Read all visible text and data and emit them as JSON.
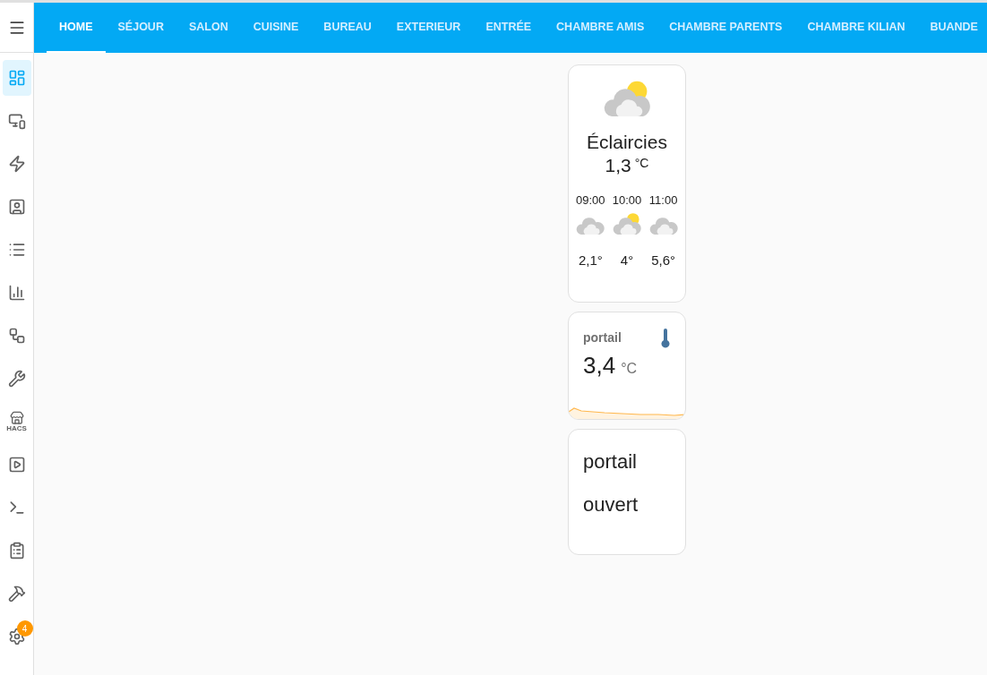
{
  "sidebar": {
    "items": [
      {
        "selected": true
      },
      {
        "selected": false
      },
      {
        "selected": false
      },
      {
        "selected": false
      },
      {
        "selected": false
      },
      {
        "selected": false
      },
      {
        "selected": false
      },
      {
        "selected": false
      },
      {
        "label": "HACS",
        "selected": false
      },
      {
        "selected": false
      },
      {
        "selected": false
      },
      {
        "selected": false
      },
      {
        "selected": false
      },
      {
        "badge": "4",
        "selected": false
      }
    ]
  },
  "tabs": [
    {
      "label": "HOME",
      "selected": true
    },
    {
      "label": "SÉJOUR",
      "selected": false
    },
    {
      "label": "SALON",
      "selected": false
    },
    {
      "label": "CUISINE",
      "selected": false
    },
    {
      "label": "BUREAU",
      "selected": false
    },
    {
      "label": "EXTERIEUR",
      "selected": false
    },
    {
      "label": "ENTRÉE",
      "selected": false
    },
    {
      "label": "CHAMBRE AMIS",
      "selected": false
    },
    {
      "label": "CHAMBRE PARENTS",
      "selected": false
    },
    {
      "label": "CHAMBRE KILIAN",
      "selected": false
    },
    {
      "label": "BUANDE",
      "selected": false
    }
  ],
  "weather": {
    "kind": "partly",
    "condition": "Éclaircies",
    "temperature": "1,3",
    "unit": "°C",
    "forecast": [
      {
        "time": "09:00",
        "kind": "cloudy",
        "temperature": "2,1°"
      },
      {
        "time": "10:00",
        "kind": "partly",
        "temperature": "4°"
      },
      {
        "time": "11:00",
        "kind": "cloudy",
        "temperature": "5,6°"
      }
    ]
  },
  "sensor": {
    "name": "portail",
    "value": "3,4",
    "unit": "°C"
  },
  "entity": {
    "name": "portail",
    "state": "ouvert"
  }
}
